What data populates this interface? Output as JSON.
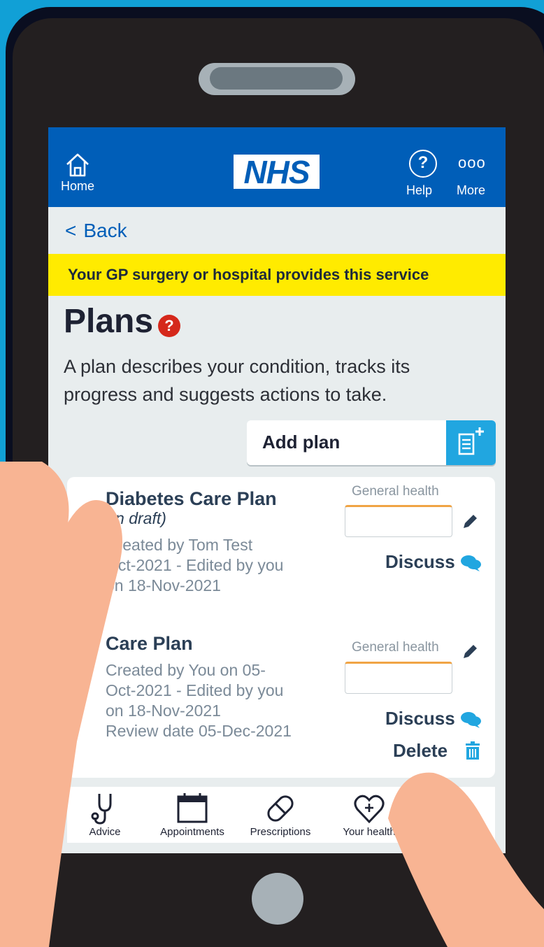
{
  "header": {
    "home_label": "Home",
    "logo": "NHS",
    "help_label": "Help",
    "more_label": "More",
    "help_glyph": "?",
    "more_glyph": "ooo"
  },
  "nav": {
    "back_label": "Back"
  },
  "banner": {
    "text": "Your GP surgery or hospital provides this service"
  },
  "page": {
    "title": "Plans",
    "help_badge": "?",
    "description": "A plan describes your condition, tracks its progress and suggests actions to take.",
    "add_plan_label": "Add plan"
  },
  "plans": [
    {
      "title": "Diabetes Care Plan",
      "status": "(In draft)",
      "meta_line1": "Created by Tom Test",
      "meta_line2": "Oct-2021 - Edited by you",
      "meta_line3": "on 18-Nov-2021",
      "category": "General health",
      "discuss_label": "Discuss"
    },
    {
      "title": "Care Plan",
      "meta_line1": "Created by You on 05-",
      "meta_line2": "Oct-2021 - Edited by you",
      "meta_line3": "on 18-Nov-2021",
      "meta_line4": "Review date 05-Dec-2021",
      "category": "General health",
      "discuss_label": "Discuss",
      "delete_label": "Delete"
    }
  ],
  "tabbar": {
    "items": [
      {
        "label": "Advice",
        "icon": "stethoscope-icon"
      },
      {
        "label": "Appointments",
        "icon": "calendar-icon"
      },
      {
        "label": "Prescriptions",
        "icon": "pill-icon"
      },
      {
        "label": "Your health",
        "icon": "heart-icon"
      }
    ]
  },
  "colors": {
    "nhs_blue": "#005eb8",
    "banner_yellow": "#ffeb00",
    "accent_cyan": "#21a6e0",
    "help_red": "#d5281b"
  }
}
